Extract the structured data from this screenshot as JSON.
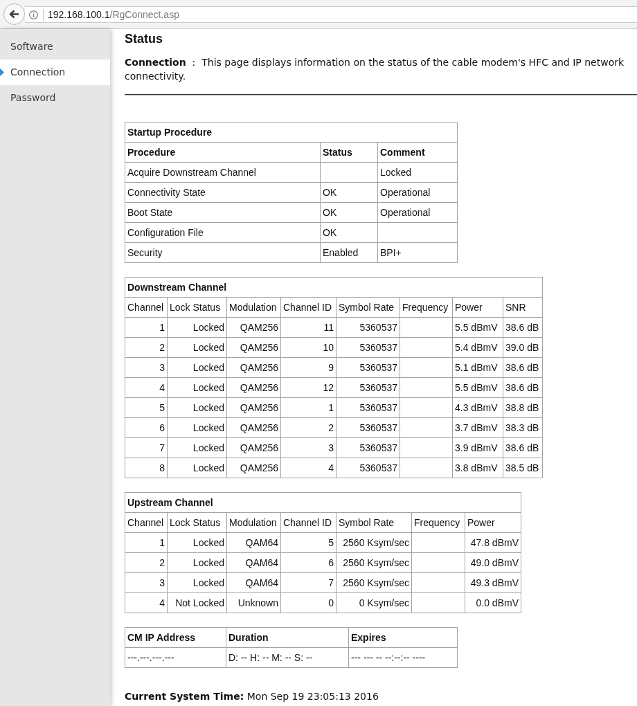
{
  "address_bar": {
    "host": "192.168.100.1",
    "path": "/RgConnect.asp"
  },
  "sidebar": {
    "items": [
      {
        "label": "Software",
        "selected": false
      },
      {
        "label": "Connection",
        "selected": true
      },
      {
        "label": "Password",
        "selected": false
      }
    ]
  },
  "content": {
    "title": "Status",
    "description": "**Connection**  :  This page displays information on the status of the cable modem's HFC and IP network connectivity.",
    "startup_procedure": {
      "title": "Startup Procedure",
      "columns": [
        "Procedure",
        "Status",
        "Comment"
      ],
      "rows": [
        {
          "procedure": "Acquire Downstream Channel",
          "comment": "Locked"
        },
        {
          "procedure": "Connectivity State",
          "status": "OK",
          "comment": "Operational"
        },
        {
          "procedure": "Boot State",
          "status": "OK",
          "comment": "Operational"
        },
        {
          "procedure": "Configuration File",
          "status": "OK"
        },
        {
          "procedure": "Security",
          "status": "Enabled",
          "comment": "BPI+"
        }
      ]
    },
    "downstream_channel": {
      "title": "Downstream Channel",
      "columns": [
        "Channel",
        "Lock Status",
        "Modulation",
        "Channel ID",
        "Symbol Rate",
        "Frequency",
        "Power",
        "SNR"
      ],
      "rows": [
        {
          "channel": "1",
          "lock_status": "Locked",
          "modulation": "QAM256",
          "channel_id": "11",
          "symbol_rate": "5360537",
          "power": "5.5 dBmV",
          "snr": "38.6 dB"
        },
        {
          "channel": "2",
          "lock_status": "Locked",
          "modulation": "QAM256",
          "channel_id": "10",
          "symbol_rate": "5360537",
          "power": "5.4 dBmV",
          "snr": "39.0 dB"
        },
        {
          "channel": "3",
          "lock_status": "Locked",
          "modulation": "QAM256",
          "channel_id": "9",
          "symbol_rate": "5360537",
          "power": "5.1 dBmV",
          "snr": "38.6 dB"
        },
        {
          "channel": "4",
          "lock_status": "Locked",
          "modulation": "QAM256",
          "channel_id": "12",
          "symbol_rate": "5360537",
          "power": "5.5 dBmV",
          "snr": "38.6 dB"
        },
        {
          "channel": "5",
          "lock_status": "Locked",
          "modulation": "QAM256",
          "channel_id": "1",
          "symbol_rate": "5360537",
          "power": "4.3 dBmV",
          "snr": "38.8 dB"
        },
        {
          "channel": "6",
          "lock_status": "Locked",
          "modulation": "QAM256",
          "channel_id": "2",
          "symbol_rate": "5360537",
          "power": "3.7 dBmV",
          "snr": "38.3 dB"
        },
        {
          "channel": "7",
          "lock_status": "Locked",
          "modulation": "QAM256",
          "channel_id": "3",
          "symbol_rate": "5360537",
          "power": "3.9 dBmV",
          "snr": "38.6 dB"
        },
        {
          "channel": "8",
          "lock_status": "Locked",
          "modulation": "QAM256",
          "channel_id": "4",
          "symbol_rate": "5360537",
          "power": "3.8 dBmV",
          "snr": "38.5 dB"
        }
      ]
    },
    "upstream_channel": {
      "title": "Upstream Channel",
      "columns": [
        "Channel",
        "Lock Status",
        "Modulation",
        "Channel ID",
        "Symbol Rate",
        "Frequency",
        "Power"
      ],
      "rows": [
        {
          "channel": "1",
          "lock_status": "Locked",
          "modulation": "QAM64",
          "channel_id": "5",
          "symbol_rate": "2560 Ksym/sec",
          "power": "47.8 dBmV"
        },
        {
          "channel": "2",
          "lock_status": "Locked",
          "modulation": "QAM64",
          "channel_id": "6",
          "symbol_rate": "2560 Ksym/sec",
          "power": "49.0 dBmV"
        },
        {
          "channel": "3",
          "lock_status": "Locked",
          "modulation": "QAM64",
          "channel_id": "7",
          "symbol_rate": "2560 Ksym/sec",
          "power": "49.3 dBmV"
        },
        {
          "channel": "4",
          "lock_status": "Not Locked",
          "modulation": "Unknown",
          "channel_id": "0",
          "symbol_rate": "0 Ksym/sec",
          "power": "0.0 dBmV"
        }
      ]
    },
    "ip_lease": {
      "columns": [
        "CM IP Address",
        "Duration",
        "Expires"
      ],
      "rows": [
        {
          "cm_ip_address": "---.---.---.---",
          "duration": "D: -- H: -- M: -- S: --",
          "expires": "--- --- -- --:--:-- ----"
        }
      ]
    },
    "current_system_time": "**Current System Time:** Mon Sep 19 23:05:13 2016"
  }
}
